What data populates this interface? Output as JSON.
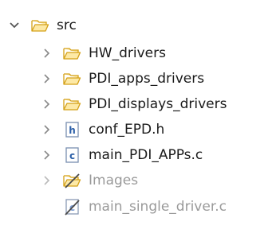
{
  "explorer": {
    "root": {
      "label": "src",
      "icon": "open-folder-icon",
      "expanded": true
    },
    "items": [
      {
        "label": "HW_drivers",
        "icon": "folder-icon",
        "kind": "folder",
        "muted": false
      },
      {
        "label": "PDI_apps_drivers",
        "icon": "folder-icon",
        "kind": "folder",
        "muted": false
      },
      {
        "label": "PDI_displays_drivers",
        "icon": "folder-icon",
        "kind": "folder",
        "muted": false
      },
      {
        "label": "conf_EPD.h",
        "icon": "header-file-icon",
        "kind": "file",
        "muted": false
      },
      {
        "label": "main_PDI_APPs.c",
        "icon": "c-file-icon",
        "kind": "file",
        "muted": false
      },
      {
        "label": "Images",
        "icon": "excluded-folder-icon",
        "kind": "folder",
        "muted": true
      },
      {
        "label": "main_single_driver.c",
        "icon": "excluded-c-file-icon",
        "kind": "file",
        "muted": true
      }
    ],
    "colors": {
      "folder_fill": "#fde9a6",
      "folder_stroke": "#d4a017",
      "file_stroke": "#7a8fb0",
      "file_accent": "#2b5fa8",
      "chevron": "#666666",
      "muted_text": "#9a9a9a"
    }
  }
}
